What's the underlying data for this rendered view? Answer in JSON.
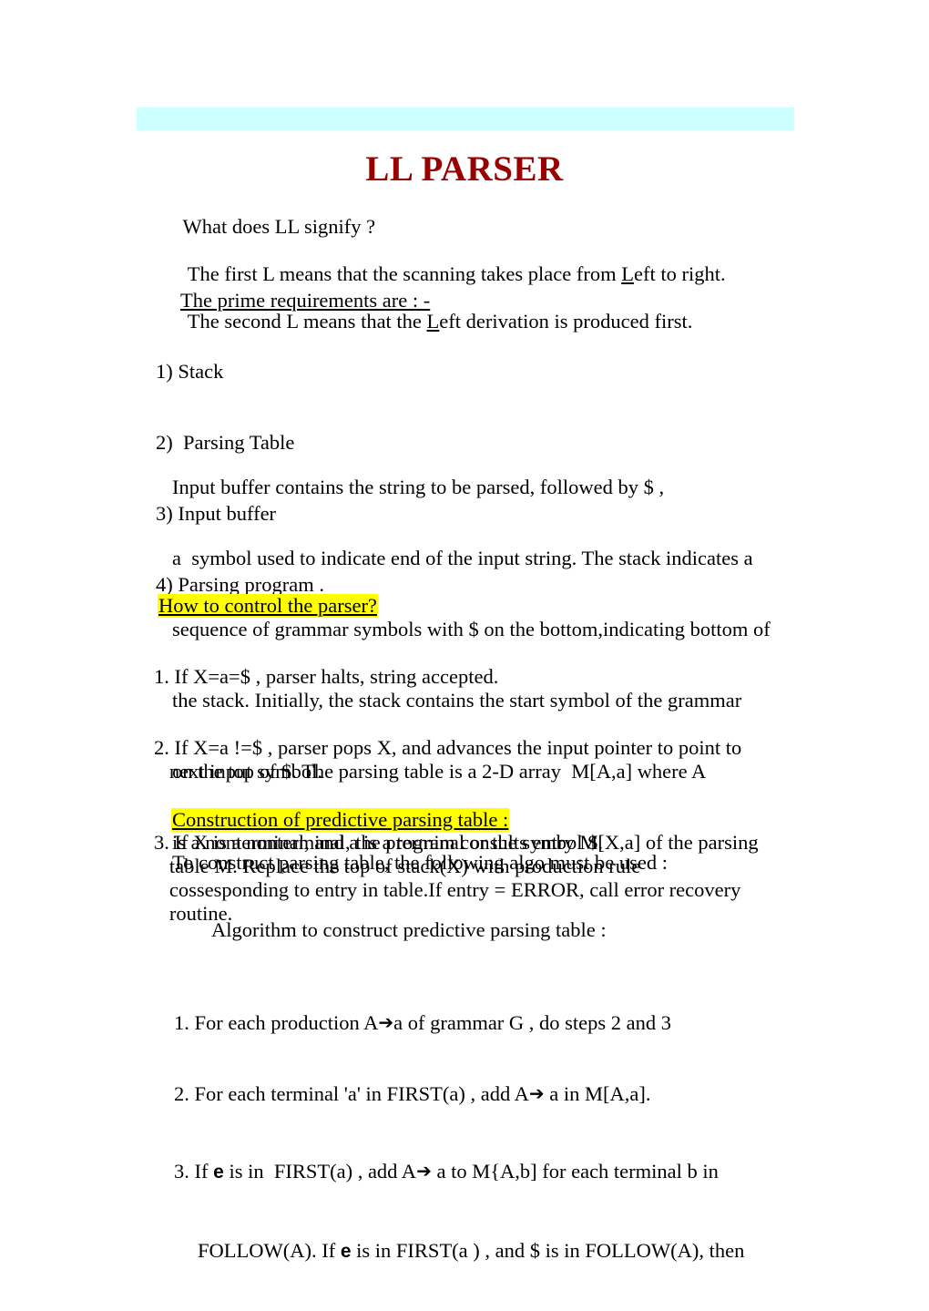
{
  "document": {
    "title": "LL PARSER",
    "title_color": "#990000",
    "banner_color": "#ccffff",
    "highlight_color": "#ffff00",
    "background_color": "#ffffff"
  },
  "intro": {
    "question": "What does LL signify ?",
    "line_first_pre": " The first L means that the scanning takes place from ",
    "line_first_underlined": "L",
    "line_first_post": "eft to right.",
    "line_second_pre": " The second L means that the ",
    "line_second_underlined": "L",
    "line_second_post": "eft derivation is produced first."
  },
  "requirements": {
    "heading": "The prime requirements are : -",
    "items": [
      "1) Stack",
      "2)  Parsing Table",
      "3) Input buffer",
      "4) Parsing program ."
    ]
  },
  "main_paragraph": {
    "lines": [
      "Input buffer contains the string to be parsed, followed by $ ,",
      "a  symbol used to indicate end of the input string. The stack indicates a",
      "sequence of grammar symbols with $ on the bottom,indicating bottom of",
      "the stack. Initially, the stack contains the start symbol of the grammar",
      "on the top of $. The parsing table is a 2-D array  M[A,a] where A",
      "is a nonterminal, and a is a terminal or the symbol $."
    ]
  },
  "control_section": {
    "heading": "How to control the parser?",
    "items": [
      "1. If X=a=$ , parser halts, string accepted.",
      "2. If X=a !=$ , parser pops X, and advances the input pointer to point to\n   next input symbol.",
      "3. If X is a nonterminal, the program consults entry M[X,a] of the parsing\n   table M. Replace the top of stack(X) with production rule\n   cossesponding to entry in table.If entry = ERROR, call error recovery\n   routine."
    ]
  },
  "construction_section": {
    "heading": "Construction of predictive parsing table :",
    "subtitle": "To construct parsing table, the following algo must be used :",
    "algorithm_heading": "Algorithm to construct predictive parsing table :"
  },
  "algorithm_steps": {
    "step1_pre": "1. For each production A",
    "step1_arrow": "➔",
    "step1_post": "a of grammar G , do steps 2 and 3",
    "step2_pre": "2. For each terminal 'a' in FIRST(a) , add A",
    "step2_arrow": "➔",
    "step2_post": " a in M[A,a].",
    "step3_pre": "3. If ",
    "step3_eps": "e",
    "step3_mid": " is in  FIRST(a) , add A",
    "step3_arrow": "➔",
    "step3_post": " a to M{A,b] for each terminal b in",
    "step3b_pre": "FOLLOW(A). If ",
    "step3b_eps": "e",
    "step3b_post": " is in FIRST(a ) , and $ is in FOLLOW(A), then"
  }
}
